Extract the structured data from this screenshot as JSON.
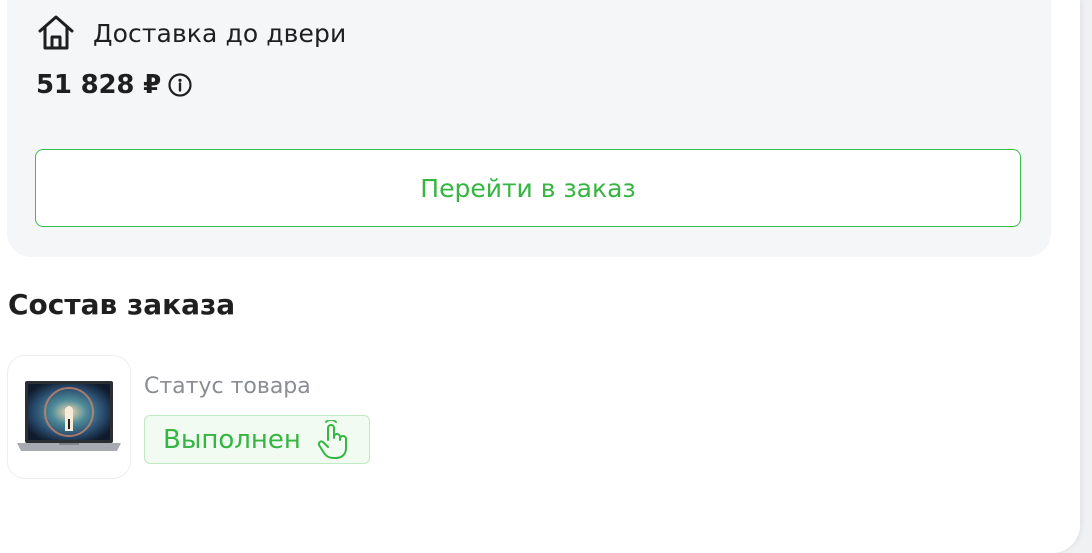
{
  "order": {
    "delivery_label": "Доставка до двери",
    "price": "51 828 ₽",
    "goto_order_label": "Перейти в заказ"
  },
  "composition": {
    "title": "Состав заказа",
    "items": [
      {
        "status_label": "Статус товара",
        "status_value": "Выполнен"
      }
    ]
  },
  "colors": {
    "accent": "#35b541",
    "card_bg": "#f5f6f8",
    "badge_bg": "#f1fbf1"
  },
  "icons": {
    "delivery": "home-icon",
    "price_info": "info-icon",
    "status": "hand-pointer-icon"
  }
}
